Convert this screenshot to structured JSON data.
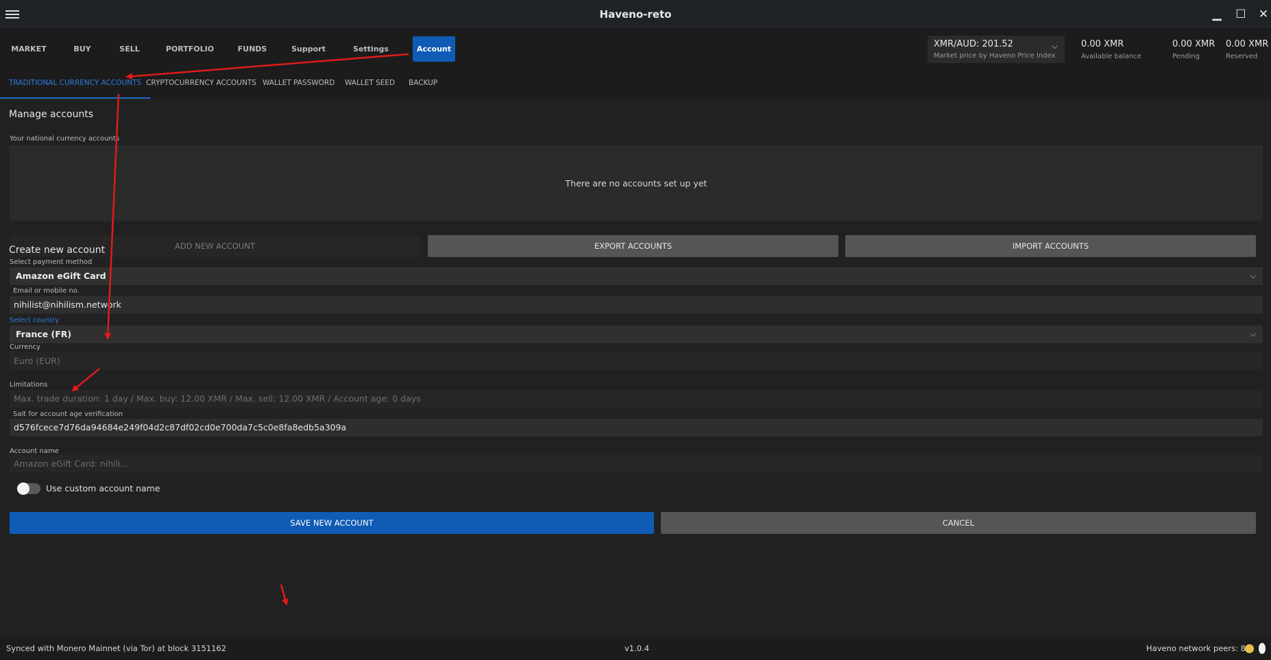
{
  "window": {
    "title": "Haveno-reto",
    "menu_icon": "hamburger-icon",
    "minimize_icon": "minimize-icon",
    "maximize_icon": "maximize-icon",
    "close_icon": "close-icon",
    "minimize_glyph": "▁",
    "maximize_glyph": "☐",
    "close_glyph": "✕"
  },
  "nav": {
    "tabs": [
      "MARKET",
      "BUY",
      "SELL",
      "PORTFOLIO",
      "FUNDS",
      "Support",
      "Settings",
      "Account"
    ],
    "active_tab": "Account",
    "price": {
      "value": "XMR/AUD: 201.52",
      "subtitle": "Market price by Haveno Price Index",
      "chevron": "⌵"
    },
    "balances": [
      {
        "value": "0.00 XMR",
        "label": "Available balance"
      },
      {
        "value": "0.00 XMR",
        "label": "Pending"
      },
      {
        "value": "0.00 XMR",
        "label": "Reserved"
      }
    ]
  },
  "subtabs": {
    "items": [
      "TRADITIONAL CURRENCY ACCOUNTS",
      "CRYPTOCURRENCY ACCOUNTS",
      "WALLET PASSWORD",
      "WALLET SEED",
      "BACKUP"
    ],
    "active": "TRADITIONAL CURRENCY ACCOUNTS"
  },
  "manage": {
    "title": "Manage accounts",
    "list_label": "Your national currency accounts",
    "empty_text": "There are no accounts set up yet",
    "add_button": "ADD NEW ACCOUNT",
    "export_button": "EXPORT ACCOUNTS",
    "import_button": "IMPORT ACCOUNTS"
  },
  "create": {
    "title": "Create new account",
    "payment_method_label": "Select payment method",
    "payment_method_value": "Amazon eGift Card",
    "email_label": "Email or mobile no.",
    "email_value": "nihilist@nihilism.network",
    "country_label": "Select country",
    "country_value": "France (FR)",
    "currency_label": "Currency",
    "currency_value": "Euro (EUR)",
    "limitations_label": "Limitations",
    "limitations_value": "Max. trade duration: 1 day / Max. buy: 12.00 XMR / Max. sell: 12.00 XMR / Account age: 0 days",
    "salt_label": "Salt for account age verification",
    "salt_value": "d576fcece7d76da94684e249f04d2c87df02cd0e700da7c5c0e8fa8edb5a309a",
    "account_name_label": "Account name",
    "account_name_value": "Amazon eGift Card: nihili...",
    "custom_name_toggle_label": "Use custom account name",
    "custom_name_toggle_on": false,
    "save_button": "SAVE NEW ACCOUNT",
    "cancel_button": "CANCEL",
    "select_chevron": "⌵"
  },
  "status": {
    "sync_text": "Synced with Monero Mainnet (via Tor) at block 3151162",
    "version": "v1.0.4",
    "peers_text": "Haveno network peers: 8",
    "peer_icon": "peer-status-dot-icon",
    "tor_icon": "tor-onion-icon"
  },
  "colors": {
    "accent": "#0f5bb5",
    "annotation_arrows": "#e01b1b",
    "peer_dot": "#e8c14a"
  }
}
